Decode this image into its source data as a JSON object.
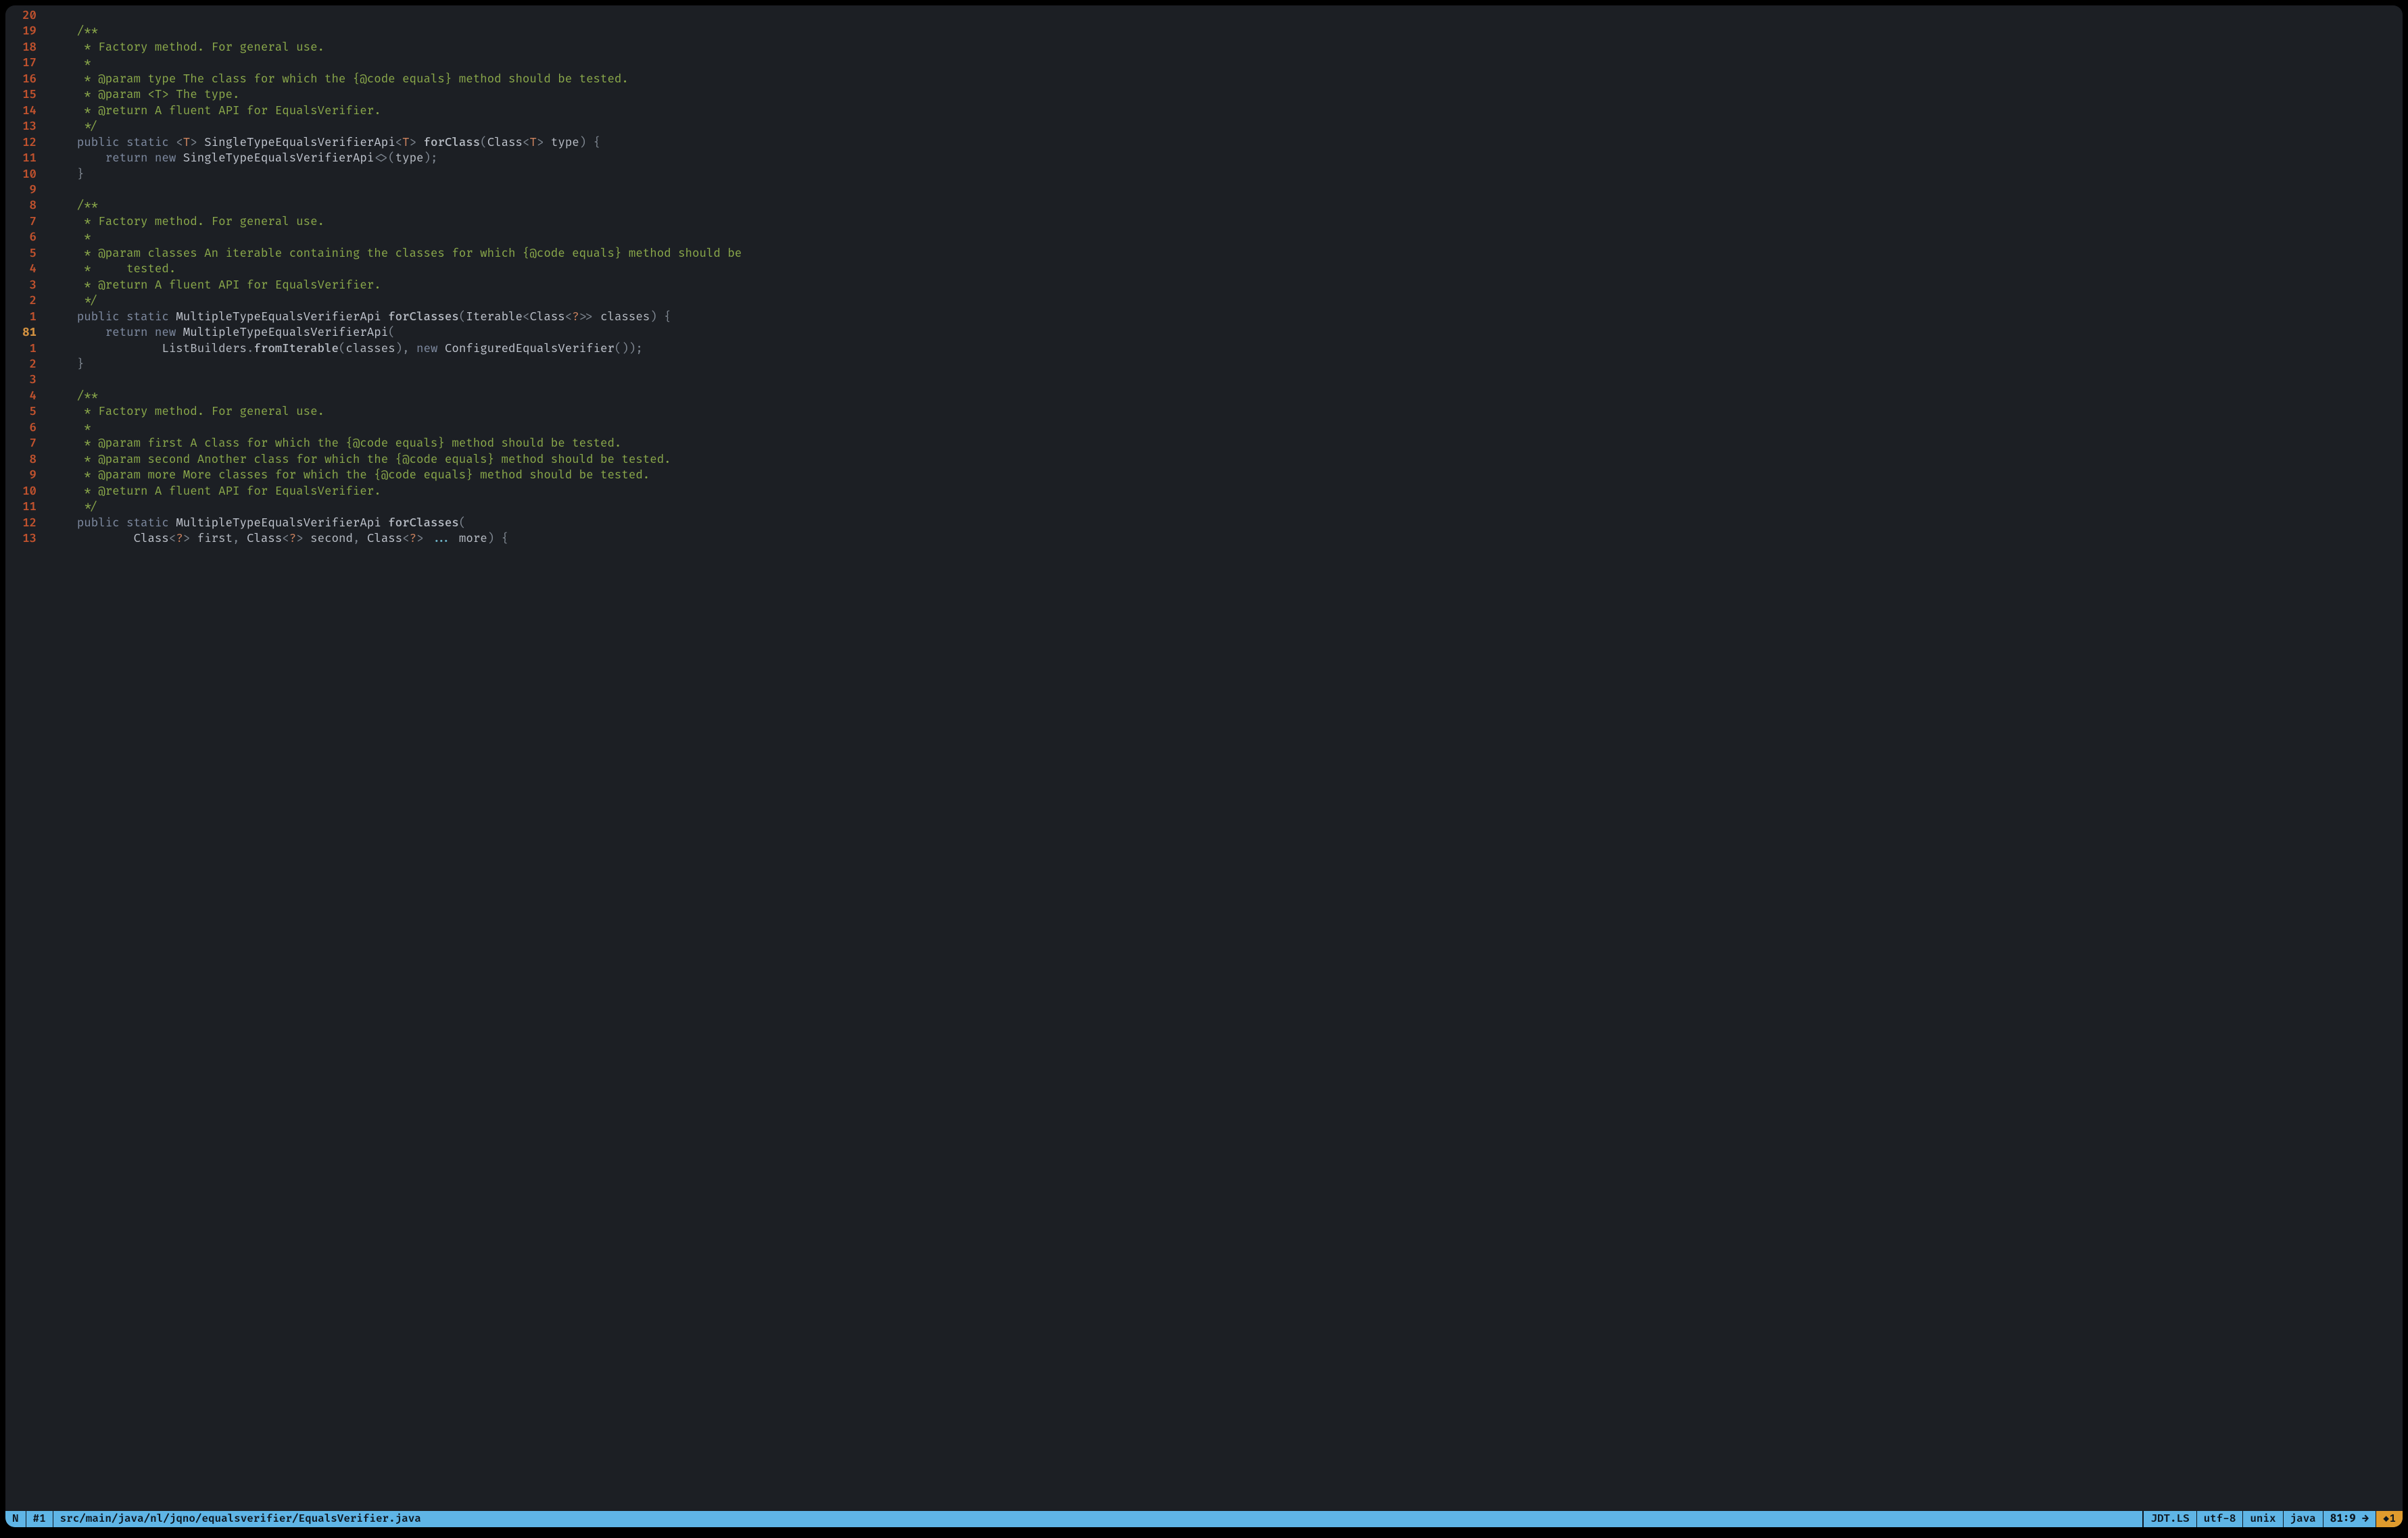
{
  "gutter": {
    "relnums": [
      "20",
      "19",
      "18",
      "17",
      "16",
      "15",
      "14",
      "13",
      "12",
      "11",
      "10",
      "9",
      "8",
      "7",
      "6",
      "5",
      "4",
      "3",
      "2",
      "1",
      "81",
      "1",
      "2",
      "3",
      "4",
      "5",
      "6",
      "7",
      "8",
      "9",
      "10",
      "11",
      "12",
      "13"
    ],
    "current_index": 20
  },
  "code": {
    "lines": [
      [],
      [
        {
          "c": "tk-doc",
          "t": "    /**"
        }
      ],
      [
        {
          "c": "tk-doc",
          "t": "     * Factory method. For general use."
        }
      ],
      [
        {
          "c": "tk-doc",
          "t": "     *"
        }
      ],
      [
        {
          "c": "tk-doc",
          "t": "     * @param type The class for which the {@code equals} method should be tested."
        }
      ],
      [
        {
          "c": "tk-doc",
          "t": "     * @param <T> The type."
        }
      ],
      [
        {
          "c": "tk-doc",
          "t": "     * @return A fluent API for EqualsVerifier."
        }
      ],
      [
        {
          "c": "tk-doc",
          "t": "     */"
        }
      ],
      [
        {
          "c": "tk-kw",
          "t": "    public static "
        },
        {
          "c": "tk-punct",
          "t": "<"
        },
        {
          "c": "tk-tp",
          "t": "T"
        },
        {
          "c": "tk-punct",
          "t": "> "
        },
        {
          "c": "tk-type",
          "t": "SingleTypeEqualsVerifierApi"
        },
        {
          "c": "tk-punct",
          "t": "<"
        },
        {
          "c": "tk-tp",
          "t": "T"
        },
        {
          "c": "tk-punct",
          "t": "> "
        },
        {
          "c": "tk-fn",
          "t": "forClass"
        },
        {
          "c": "tk-punct",
          "t": "("
        },
        {
          "c": "tk-type",
          "t": "Class"
        },
        {
          "c": "tk-punct",
          "t": "<"
        },
        {
          "c": "tk-tp",
          "t": "T"
        },
        {
          "c": "tk-punct",
          "t": "> "
        },
        {
          "c": "tk-id",
          "t": "type"
        },
        {
          "c": "tk-punct",
          "t": ") "
        },
        {
          "c": "tk-br",
          "t": "{"
        }
      ],
      [
        {
          "c": "tk-kw",
          "t": "        return new "
        },
        {
          "c": "tk-type",
          "t": "SingleTypeEqualsVerifierApi"
        },
        {
          "c": "tk-punct",
          "t": "<>("
        },
        {
          "c": "tk-id",
          "t": "type"
        },
        {
          "c": "tk-punct",
          "t": ");"
        }
      ],
      [
        {
          "c": "tk-br",
          "t": "    }"
        }
      ],
      [],
      [
        {
          "c": "tk-doc",
          "t": "    /**"
        }
      ],
      [
        {
          "c": "tk-doc",
          "t": "     * Factory method. For general use."
        }
      ],
      [
        {
          "c": "tk-doc",
          "t": "     *"
        }
      ],
      [
        {
          "c": "tk-doc",
          "t": "     * @param classes An iterable containing the classes for which {@code equals} method should be"
        }
      ],
      [
        {
          "c": "tk-doc",
          "t": "     *     tested."
        }
      ],
      [
        {
          "c": "tk-doc",
          "t": "     * @return A fluent API for EqualsVerifier."
        }
      ],
      [
        {
          "c": "tk-doc",
          "t": "     */"
        }
      ],
      [
        {
          "c": "tk-kw",
          "t": "    public static "
        },
        {
          "c": "tk-type",
          "t": "MultipleTypeEqualsVerifierApi "
        },
        {
          "c": "tk-fn",
          "t": "forClasses"
        },
        {
          "c": "tk-punct",
          "t": "("
        },
        {
          "c": "tk-type",
          "t": "Iterable"
        },
        {
          "c": "tk-punct",
          "t": "<"
        },
        {
          "c": "tk-type",
          "t": "Class"
        },
        {
          "c": "tk-punct",
          "t": "<"
        },
        {
          "c": "tk-tp",
          "t": "?"
        },
        {
          "c": "tk-punct",
          "t": ">> "
        },
        {
          "c": "tk-id",
          "t": "classes"
        },
        {
          "c": "tk-punct",
          "t": ") "
        },
        {
          "c": "tk-br",
          "t": "{"
        }
      ],
      [
        {
          "c": "tk-kw",
          "t": "        return new "
        },
        {
          "c": "tk-type",
          "t": "MultipleTypeEqualsVerifierApi"
        },
        {
          "c": "tk-punct",
          "t": "("
        }
      ],
      [
        {
          "c": "tk-id",
          "t": "                ListBuilders"
        },
        {
          "c": "tk-punct",
          "t": "."
        },
        {
          "c": "tk-fn",
          "t": "fromIterable"
        },
        {
          "c": "tk-punct",
          "t": "("
        },
        {
          "c": "tk-id",
          "t": "classes"
        },
        {
          "c": "tk-punct",
          "t": "), "
        },
        {
          "c": "tk-kw",
          "t": "new "
        },
        {
          "c": "tk-type",
          "t": "ConfiguredEqualsVerifier"
        },
        {
          "c": "tk-punct",
          "t": "());"
        }
      ],
      [
        {
          "c": "tk-br",
          "t": "    }"
        }
      ],
      [],
      [
        {
          "c": "tk-doc",
          "t": "    /**"
        }
      ],
      [
        {
          "c": "tk-doc",
          "t": "     * Factory method. For general use."
        }
      ],
      [
        {
          "c": "tk-doc",
          "t": "     *"
        }
      ],
      [
        {
          "c": "tk-doc",
          "t": "     * @param first A class for which the {@code equals} method should be tested."
        }
      ],
      [
        {
          "c": "tk-doc",
          "t": "     * @param second Another class for which the {@code equals} method should be tested."
        }
      ],
      [
        {
          "c": "tk-doc",
          "t": "     * @param more More classes for which the {@code equals} method should be tested."
        }
      ],
      [
        {
          "c": "tk-doc",
          "t": "     * @return A fluent API for EqualsVerifier."
        }
      ],
      [
        {
          "c": "tk-doc",
          "t": "     */"
        }
      ],
      [
        {
          "c": "tk-kw",
          "t": "    public static "
        },
        {
          "c": "tk-type",
          "t": "MultipleTypeEqualsVerifierApi "
        },
        {
          "c": "tk-fn",
          "t": "forClasses"
        },
        {
          "c": "tk-punct",
          "t": "("
        }
      ],
      [
        {
          "c": "tk-id",
          "t": "            "
        },
        {
          "c": "tk-type",
          "t": "Class"
        },
        {
          "c": "tk-punct",
          "t": "<"
        },
        {
          "c": "tk-tp",
          "t": "?"
        },
        {
          "c": "tk-punct",
          "t": "> "
        },
        {
          "c": "tk-id",
          "t": "first"
        },
        {
          "c": "tk-punct",
          "t": ", "
        },
        {
          "c": "tk-type",
          "t": "Class"
        },
        {
          "c": "tk-punct",
          "t": "<"
        },
        {
          "c": "tk-tp",
          "t": "?"
        },
        {
          "c": "tk-punct",
          "t": "> "
        },
        {
          "c": "tk-id",
          "t": "second"
        },
        {
          "c": "tk-punct",
          "t": ", "
        },
        {
          "c": "tk-type",
          "t": "Class"
        },
        {
          "c": "tk-punct",
          "t": "<"
        },
        {
          "c": "tk-tp",
          "t": "?"
        },
        {
          "c": "tk-punct",
          "t": ">"
        },
        {
          "c": "tk-dots",
          "t": " ... "
        },
        {
          "c": "tk-id",
          "t": "more"
        },
        {
          "c": "tk-punct",
          "t": ") "
        },
        {
          "c": "tk-br",
          "t": "{"
        }
      ]
    ]
  },
  "statusline": {
    "mode": "N",
    "window": "#1",
    "path": "src/main/java/nl/jqno/equalsverifier/EqualsVerifier.java",
    "lsp": "JDT.LS",
    "encoding": "utf-8",
    "ff": "unix",
    "ft": "java",
    "pos": "81:9 →",
    "diag": "◆1"
  }
}
